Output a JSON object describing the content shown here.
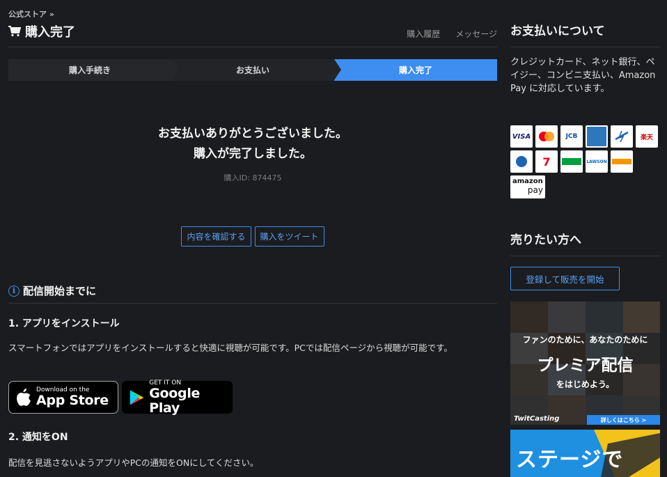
{
  "breadcrumb": "公式ストア »",
  "page": {
    "title": "購入完了",
    "links": [
      "購入履歴",
      "メッセージ"
    ]
  },
  "steps": [
    {
      "label": "購入手続き",
      "active": false
    },
    {
      "label": "お支払い",
      "active": false
    },
    {
      "label": "購入完了",
      "active": true
    }
  ],
  "thanks": {
    "line1": "お支払いありがとうございました。",
    "line2": "購入が完了しました。",
    "purchase_id": "購入ID: 874475"
  },
  "actions": {
    "confirm": "内容を確認する",
    "tweet": "購入をツイート"
  },
  "before_stream": {
    "heading": "配信開始までに",
    "step1_title": "1. アプリをインストール",
    "step1_text": "スマートフォンではアプリをインストールすると快適に視聴が可能です。PCでは配信ページから視聴が可能です。",
    "step2_title": "2. 通知をON",
    "step2_text": "配信を見逃さないようアプリやPCの通知をONにしてください。"
  },
  "badges": {
    "appstore_small": "Download on the",
    "appstore_big": "App Store",
    "google_small": "GET IT ON",
    "google_big": "Google Play"
  },
  "sidebar": {
    "payment_title": "お支払いについて",
    "payment_text": "クレジットカード、ネット銀行、ペイジー、コンビニ支払い、Amazon Pay に対応しています。",
    "payment_methods": [
      {
        "name": "VISA",
        "color": "#1a1f71"
      },
      {
        "name": "",
        "color": "#eb001b"
      },
      {
        "name": "JCB",
        "color": "#0b4ea2"
      },
      {
        "name": "",
        "color": "#2e77bc"
      },
      {
        "name": "",
        "color": "#1d62b0"
      },
      {
        "name": "楽天",
        "color": "#bf0000"
      },
      {
        "name": "",
        "color": "#1e64b4"
      },
      {
        "name": "7",
        "color": "#e60012"
      },
      {
        "name": "",
        "color": "#00a040"
      },
      {
        "name": "LAWSON",
        "color": "#0068b7"
      },
      {
        "name": "",
        "color": "#f39800"
      }
    ],
    "amazon_top": "amazon",
    "amazon_bottom": "pay",
    "sell_title": "売りたい方へ",
    "sell_button": "登録して販売を開始",
    "banner1": {
      "line1": "ファンのために、あなたのために",
      "line2": "プレミア配信",
      "line3": "をはじめよう。",
      "brand": "TwitCasting",
      "more": "詳しくはこちら >"
    },
    "banner2_text": "ステージで"
  }
}
